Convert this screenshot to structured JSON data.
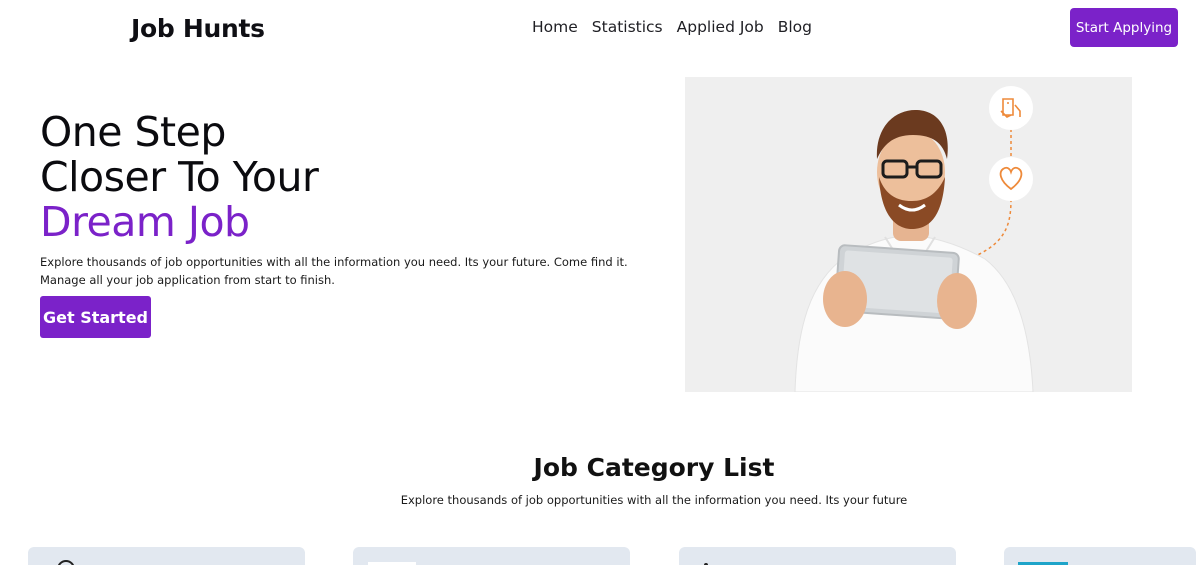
{
  "header": {
    "brand": "Job Hunts",
    "nav": [
      "Home",
      "Statistics",
      "Applied Job",
      "Blog"
    ],
    "cta_label": "Start Applying"
  },
  "hero": {
    "title_line1": "One Step",
    "title_line2": "Closer To Your",
    "title_accent": "Dream Job",
    "desc_line1": "Explore thousands of job opportunities with all the information you need. Its your future. Come find it.",
    "desc_line2": "Manage all your job application from start to finish.",
    "button_label": "Get Started"
  },
  "categories": {
    "title": "Job Category List",
    "subtitle": "Explore thousands of job opportunities with all the information you need. Its your future"
  },
  "colors": {
    "accent": "#7b22c9",
    "card_bg": "#e2e8f0",
    "icon_orange": "#ee8a3a"
  },
  "icons": [
    "tablet-hand-icon",
    "heart-icon",
    "category-icon"
  ]
}
